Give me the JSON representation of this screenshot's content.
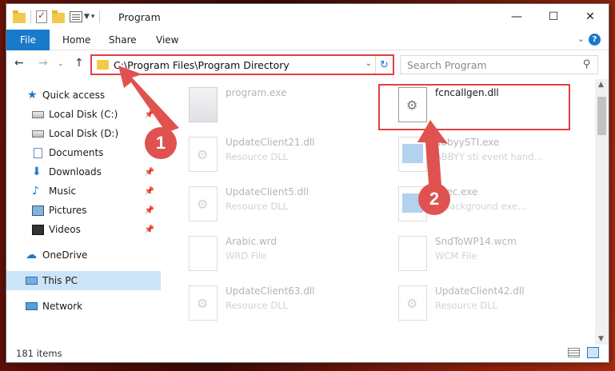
{
  "window": {
    "title": "Program",
    "controls": {
      "minimize": "—",
      "maximize": "☐",
      "close": "✕"
    }
  },
  "ribbon": {
    "file": "File",
    "tabs": [
      "Home",
      "Share",
      "View"
    ],
    "help": "?"
  },
  "nav": {
    "address": "C:\\Program Files\\Program Directory",
    "search_placeholder": "Search Program"
  },
  "sidebar": {
    "items": [
      {
        "label": "Quick access",
        "icon": "star-icon"
      },
      {
        "label": "Local Disk (C:)",
        "icon": "disk-icon",
        "pinned": true
      },
      {
        "label": "Local Disk (D:)",
        "icon": "disk-icon",
        "pinned": true
      },
      {
        "label": "Documents",
        "icon": "documents-icon",
        "pinned": true
      },
      {
        "label": "Downloads",
        "icon": "download-icon",
        "pinned": true
      },
      {
        "label": "Music",
        "icon": "music-icon",
        "pinned": true
      },
      {
        "label": "Pictures",
        "icon": "pictures-icon",
        "pinned": true
      },
      {
        "label": "Videos",
        "icon": "videos-icon",
        "pinned": true
      },
      {
        "label": "OneDrive",
        "icon": "cloud-icon"
      },
      {
        "label": "This PC",
        "icon": "pc-icon",
        "selected": true
      },
      {
        "label": "Network",
        "icon": "network-icon"
      }
    ]
  },
  "files": [
    {
      "name": "program.exe",
      "type": ""
    },
    {
      "name": "fcncallgen.dll",
      "type": ""
    },
    {
      "name": "UpdateClient21.dll",
      "type": "Resource DLL"
    },
    {
      "name": "abbyySTI.exe",
      "type": "ABBYY sti event hand..."
    },
    {
      "name": "UpdateClient5.dll",
      "type": "Resource DLL"
    },
    {
      "name": "Exec.exe",
      "type": "...background exe..."
    },
    {
      "name": "Arabic.wrd",
      "type": "WRD File"
    },
    {
      "name": "SndToWP14.wcm",
      "type": "WCM File"
    },
    {
      "name": "UpdateClient63.dll",
      "type": "Resource DLL"
    },
    {
      "name": "UpdateClient42.dll",
      "type": "Resource DLL"
    }
  ],
  "status": {
    "count": "181 items"
  },
  "annotations": {
    "step1": "1",
    "step2": "2",
    "accent": "#e0524f"
  },
  "colors": {
    "accent": "#1979ca",
    "highlight": "#e04040",
    "selection": "#cce4f7"
  }
}
